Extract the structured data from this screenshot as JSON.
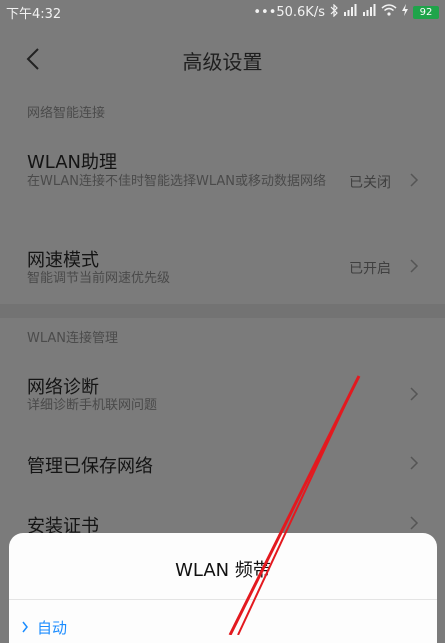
{
  "status_bar": {
    "time": "下午4:32",
    "network_speed": "•••50.6K/s",
    "battery": "92"
  },
  "header": {
    "title": "高级设置"
  },
  "sections": [
    {
      "label": "网络智能连接",
      "rows": [
        {
          "title": "WLAN助理",
          "description": "在WLAN连接不佳时智能选择WLAN或移动数据网络",
          "value": "已关闭"
        },
        {
          "title": "网速模式",
          "description": "智能调节当前网速优先级",
          "value": "已开启"
        }
      ]
    },
    {
      "label": "WLAN连接管理",
      "rows": [
        {
          "title": "网络诊断",
          "description": "详细诊断手机联网问题",
          "value": ""
        },
        {
          "title": "管理已保存网络",
          "description": "",
          "value": ""
        },
        {
          "title": "安装证书",
          "description": "",
          "value": ""
        }
      ]
    }
  ],
  "bottom_sheet": {
    "title": "WLAN  频带",
    "option": "自动"
  },
  "colors": {
    "annotation_stroke": "#e3191f",
    "accent": "#1a8cff"
  }
}
